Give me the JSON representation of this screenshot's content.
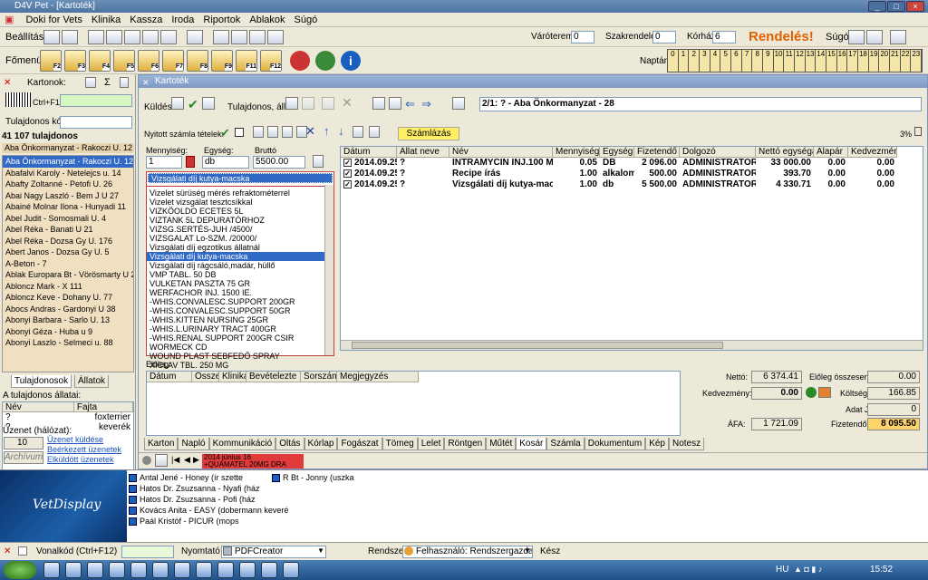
{
  "window": {
    "title": "D4V Pet - [Kartoték]"
  },
  "menu": [
    "Doki for Vets",
    "Klinika",
    "Kassza",
    "Iroda",
    "Riportok",
    "Ablakok",
    "Súgó"
  ],
  "toolbar1": {
    "settings": "Beállítás",
    "waiting_label": "Váróterem",
    "waiting_value": "0",
    "specialty_label": "Szakrendelés",
    "specialty_value": "0",
    "hospital_label": "Kórház",
    "hospital_value": "6",
    "rendeles": "Rendelés!",
    "help": "Súgó"
  },
  "toolbar2": {
    "main_menu": "Főmenü",
    "fkeys": [
      "F2",
      "F3",
      "F4",
      "F5",
      "F6",
      "F7",
      "F8",
      "F9",
      "F11",
      "F12"
    ],
    "calendar_label": "Naptár",
    "hours": [
      "0",
      "1",
      "2",
      "3",
      "4",
      "5",
      "6",
      "7",
      "8",
      "9",
      "10",
      "11",
      "12",
      "13",
      "14",
      "15",
      "16",
      "17",
      "18",
      "19",
      "20",
      "21",
      "22",
      "23"
    ]
  },
  "sidebar": {
    "kartonok": "Kartonok:",
    "ctrl_f11": "Ctrl+F11",
    "owner_code": "Tulajdonos kód:",
    "count": "41 107 tulajdonos",
    "top_item": "Aba Önkormanyzat - Rakoczi U. 12",
    "owners": [
      "Aba Önkormanyzat - Rakoczi U. 12",
      "Abafalvi Karoly - Netelejcs u. 14",
      "Abafty Zoltanné - Petofi U. 26",
      "Abai Nagy Laszló - Bem J U 27",
      "Abainé Molnar Ilona - Hunyadi 11",
      "Abel Judit - Somosmali U. 4",
      "Abel Réka - Banati U 21",
      "Abel Réka - Dozsa Gy U. 176",
      "Abert Janos - Dozsa Gy U. 5",
      "A-Beton - 7",
      "Ablak Europara Bt - Vörösmarty U 2",
      "Abloncz Mark - X 111",
      "Abloncz Keve - Dohany U. 77",
      "Abocs Andras - Gardonyi U 38",
      "Abonyi Barbara - Sarlo U. 13",
      "Abonyi Géza - Huba u 9",
      "Abonyi Laszlo - Selmeci u. 88"
    ],
    "tab_owners": "Tulajdonosok",
    "tab_animals": "Állatok",
    "animals_label": "A tulajdonos állatai:",
    "animals_headers": [
      "Név",
      "Fajta"
    ],
    "animals": [
      {
        "name": "?",
        "breed": "foxterrier"
      },
      {
        "name": "?",
        "breed": "keverék"
      }
    ],
    "message_label": "Üzenet (hálózat):",
    "message_count": "10",
    "msg_links": [
      "Üzenet küldése",
      "Beérkezett üzenetek",
      "Elküldött üzenetek"
    ],
    "archive": "Archívum"
  },
  "kartotek": {
    "title": "Kartoték",
    "send": "Küldés",
    "owner_animal": "Tulajdonos, állat",
    "header_info": "2/1: ? - Aba Önkormanyzat - 28",
    "open_items": "Nyitott számla tételek:",
    "billing_button": "Számlázás",
    "percent": "3%",
    "qty_label": "Mennyiség:",
    "qty_value": "1",
    "unit_label": "Egység:",
    "unit_value": "db",
    "gross_label": "Bruttó",
    "gross_value": "5500.00",
    "search_value": "Vizsgálati díj kutya-macska",
    "dropdown": [
      "Vizelet sürüség mérés refraktométerrel",
      "Vizelet vizsgálat tesztcsíkkal",
      "VIZKÖOLDO ECETES 5L",
      "VIZTANK 5L DEPURATÓRHOZ",
      "VIZSG.SERTÉS-JUH /4500/",
      "VIZSGALAT Lo-SZM. /20000/",
      "Vizsgálati díj egzotikus állatnál",
      "Vizsgálati díj kutya-macska",
      "Vizsgálati díj rágcsáló,madár, hüllő",
      "VMP TABL. 50 DB",
      "VULKETAN PASZTA 75 GR",
      "WERFACHOR INJ. 1500 IE.",
      "-WHIS.CONVALESC.SUPPORT 200GR",
      "-WHIS.CONVALESC.SUPPORT 50GR",
      "-WHIS.KITTEN NURSING 25GR",
      "-WHIS.L.URINARY TRACT 400GR",
      "-WHIS.RENAL SUPPORT 200GR CSIR",
      "WORMECK CD",
      "WOUND PLAST SEBFEDŐ SPRAY",
      "XICLAV TBL. 250 MG"
    ],
    "selected_index": 7,
    "table_headers": [
      "Dátum",
      "Állat neve",
      "Név",
      "Mennyiség",
      "Egység",
      "Fizetendő",
      "Dolgozó",
      "Nettó egységár",
      "Alapár",
      "Kedvezmény"
    ],
    "rows": [
      [
        "2014.09.25",
        "?",
        "INTRAMYCIN INJ.100 ML",
        "0.05",
        "DB",
        "2 096.00",
        "ADMINISTRATOR",
        "33 000.00",
        "0.00",
        "0.00"
      ],
      [
        "2014.09.25",
        "?",
        "Recipe írás",
        "1.00",
        "alkalom",
        "500.00",
        "ADMINISTRATOR",
        "393.70",
        "0.00",
        "0.00"
      ],
      [
        "2014.09.25",
        "?",
        "Vizsgálati díj kutya-macska",
        "1.00",
        "db",
        "5 500.00",
        "ADMINISTRATOR",
        "4 330.71",
        "0.00",
        "0.00"
      ]
    ],
    "advance_label": "Előleg:",
    "advance_headers": [
      "Dátum",
      "Összeg",
      "Klinika",
      "Bevételezte",
      "Sorszám",
      "Megjegyzés"
    ],
    "totals": {
      "net_label": "Nettó:",
      "net": "6 374.41",
      "discount_label": "Kedvezmény:",
      "discount": "0.00",
      "vat_label": "ÁFA:",
      "vat": "1 721.09",
      "advance_sum_label": "Előleg összesen:",
      "advance_sum": "0.00",
      "cost_label": "Költség:",
      "cost": "166.85",
      "adat_label": "Adat J:",
      "adat": "0",
      "payable_label": "Fizetendő:",
      "payable": "8 095.50"
    },
    "bottom_tabs": [
      "Karton",
      "Napló",
      "Kommunikáció",
      "Oltás",
      "Kórlap",
      "Fogászat",
      "Tömeg",
      "Lelet",
      "Röntgen",
      "Műtét",
      "Kosár",
      "Számla",
      "Dokumentum",
      "Kép",
      "Notesz"
    ],
    "active_tab": "Kosár",
    "date_note": "2014 június 16",
    "drug_note": "+QUAMATEL 20MG DRA"
  },
  "display": {
    "logo": "VetDisplay",
    "patients_left": [
      "Antal Jené - Honey (ír szette",
      "Hatos Dr. Zsuzsanna - Nyafi (ház",
      "Hatos Dr. Zsuzsanna - Pofi (ház",
      "Kovács Anita - EASY (dobermann keveré",
      "Paál Kristóf - PICUR (mops"
    ],
    "patients_right": [
      "R Bt - Jonny (uszka"
    ]
  },
  "statusbar": {
    "barcode": "Vonalkód (Ctrl+F12)",
    "printer_label": "Nyomtató",
    "printer_value": "PDFCreator",
    "system_label": "Rendszer",
    "user_value": "Felhasználó: Rendszergazda (Re",
    "ready": "Kész"
  },
  "taskbar": {
    "lang": "HU",
    "time": "15:52"
  }
}
